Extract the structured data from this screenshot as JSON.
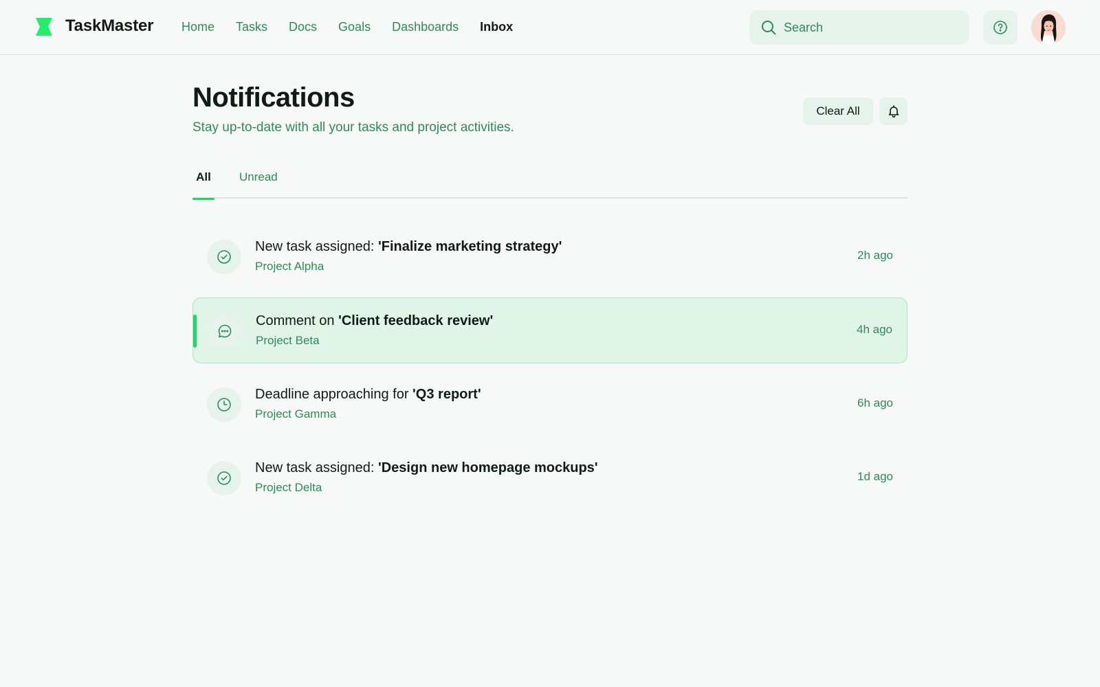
{
  "app": {
    "brand": "TaskMaster"
  },
  "nav": {
    "items": [
      {
        "label": "Home"
      },
      {
        "label": "Tasks"
      },
      {
        "label": "Docs"
      },
      {
        "label": "Goals"
      },
      {
        "label": "Dashboards"
      },
      {
        "label": "Inbox",
        "active": true
      }
    ]
  },
  "search": {
    "placeholder": "Search",
    "value": ""
  },
  "page": {
    "title": "Notifications",
    "subtitle": "Stay up-to-date with all your tasks and project activities.",
    "clear_all_label": "Clear All"
  },
  "tabs": [
    {
      "label": "All",
      "active": true
    },
    {
      "label": "Unread",
      "active": false
    }
  ],
  "notifications": [
    {
      "prefix": "New task assigned: ",
      "subject": "'Finalize marketing strategy'",
      "project": "Project Alpha",
      "time": "2h ago",
      "icon": "check-circle-icon",
      "highlighted": false
    },
    {
      "prefix": "Comment on ",
      "subject": "'Client feedback review'",
      "project": "Project Beta",
      "time": "4h ago",
      "icon": "comment-icon",
      "highlighted": true
    },
    {
      "prefix": "Deadline approaching for ",
      "subject": "'Q3 report'",
      "project": "Project Gamma",
      "time": "6h ago",
      "icon": "clock-icon",
      "highlighted": false
    },
    {
      "prefix": "New task assigned: ",
      "subject": "'Design new homepage mockups'",
      "project": "Project Delta",
      "time": "1d ago",
      "icon": "check-circle-icon",
      "highlighted": false
    }
  ],
  "colors": {
    "accent": "#22d46a",
    "text_primary": "#0f1c15",
    "text_secondary": "#2f8a59",
    "surface": "#e6f2ec",
    "background": "#f6f9f8"
  }
}
